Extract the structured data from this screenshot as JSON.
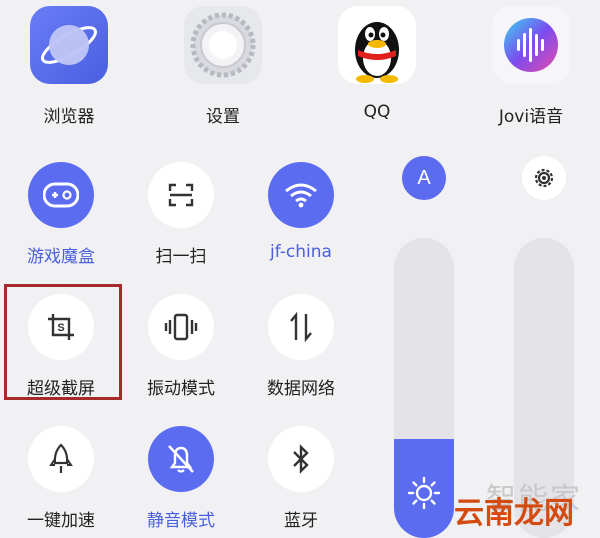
{
  "apps": [
    {
      "label": "浏览器",
      "icon": "planet-icon"
    },
    {
      "label": "设置",
      "icon": "gear-icon"
    },
    {
      "label": "QQ",
      "icon": "penguin-icon"
    },
    {
      "label": "Jovi语音",
      "icon": "voice-wave-icon"
    }
  ],
  "tiles": [
    {
      "label": "游戏魔盒",
      "icon": "gamepad-icon",
      "active": true
    },
    {
      "label": "扫一扫",
      "icon": "scan-icon",
      "active": false
    },
    {
      "label": "jf-china",
      "icon": "wifi-icon",
      "active": true
    },
    {
      "label": "超级截屏",
      "icon": "crop-screenshot-icon",
      "active": false
    },
    {
      "label": "振动模式",
      "icon": "vibrate-icon",
      "active": false
    },
    {
      "label": "数据网络",
      "icon": "data-arrows-icon",
      "active": false
    },
    {
      "label": "一键加速",
      "icon": "rocket-icon",
      "active": false
    },
    {
      "label": "静音模式",
      "icon": "bell-off-icon",
      "active": true
    },
    {
      "label": "蓝牙",
      "icon": "bluetooth-icon",
      "active": false
    }
  ],
  "auto_brightness": {
    "label": "A"
  },
  "brightness_level": 0.33,
  "colors": {
    "accent": "#5b6cf0",
    "highlight_border": "#a62a2a"
  },
  "watermark": {
    "text1": "智能家",
    "text2": "云南龙网"
  }
}
